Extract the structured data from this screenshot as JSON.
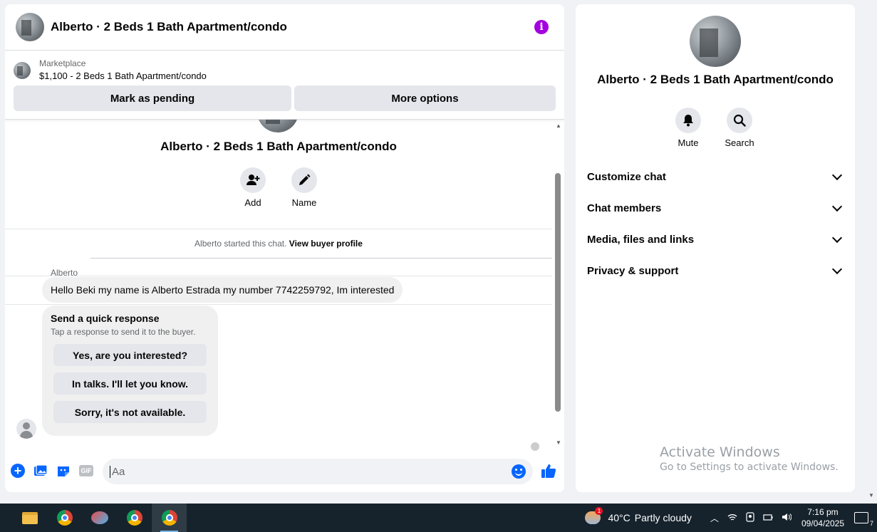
{
  "chat": {
    "title": "Alberto · 2 Beds 1 Bath Apartment/condo",
    "marketplace_label": "Marketplace",
    "listing": "$1,100 - 2 Beds 1 Bath Apartment/condo",
    "mark_pending": "Mark as pending",
    "more_options": "More options",
    "thread_title": "Alberto · 2 Beds 1 Bath Apartment/condo",
    "add_label": "Add",
    "name_label": "Name",
    "started_text": "Alberto started this chat.",
    "view_profile": "View buyer profile",
    "sender": "Alberto",
    "message": "Hello Beki my name is Alberto Estrada my number 7742259792, Im interested",
    "quick_title": "Send a quick response",
    "quick_sub": "Tap a response to send it to the buyer.",
    "quick_options": [
      "Yes, are you interested?",
      "In talks. I'll let you know.",
      "Sorry, it's not available."
    ],
    "input_placeholder": "Aa",
    "gif_label": "GIF"
  },
  "side": {
    "title": "Alberto · 2 Beds 1 Bath Apartment/condo",
    "mute_label": "Mute",
    "search_label": "Search",
    "items": [
      "Customize chat",
      "Chat members",
      "Media, files and links",
      "Privacy & support"
    ]
  },
  "watermark": {
    "line1": "Activate Windows",
    "line2": "Go to Settings to activate Windows."
  },
  "taskbar": {
    "weather_temp": "40°C",
    "weather_text": "Partly cloudy",
    "weather_badge": "1",
    "time": "7:16 pm",
    "date": "09/04/2025",
    "notif_count": "7"
  },
  "colors": {
    "accent": "#0866ff",
    "info": "#a400e0"
  }
}
